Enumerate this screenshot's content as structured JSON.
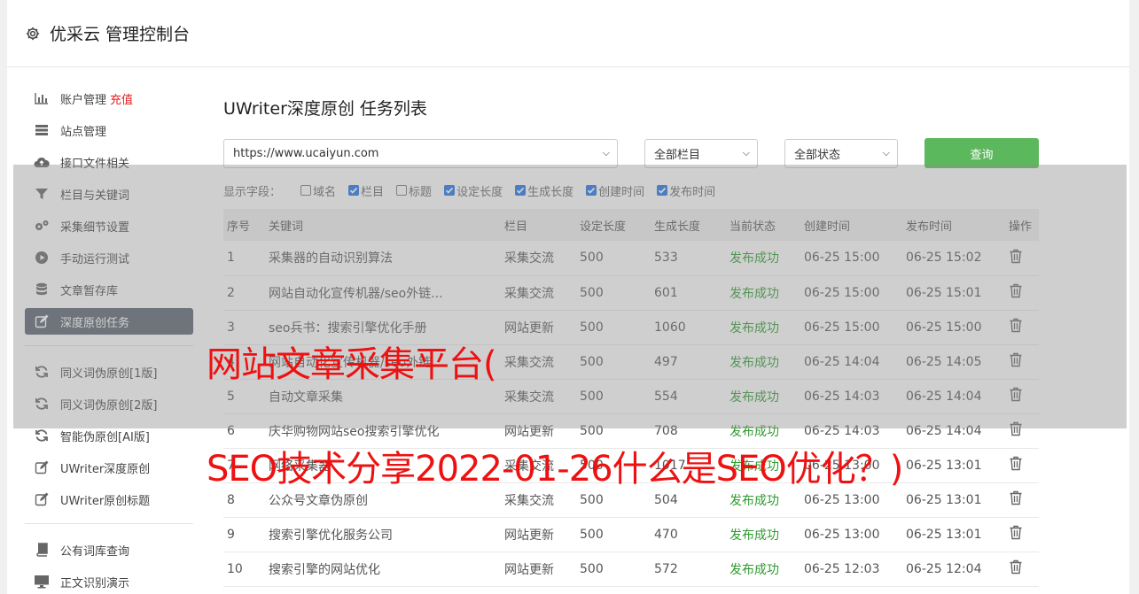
{
  "app": {
    "title": "优采云 管理控制台",
    "icon": "gear-icon"
  },
  "sidebar": {
    "items": [
      {
        "label": "账户管理",
        "badge": "充值",
        "icon": "bar-chart-icon"
      },
      {
        "label": "站点管理",
        "icon": "server-icon"
      },
      {
        "label": "接口文件相关",
        "icon": "cloud-upload-icon"
      },
      {
        "label": "栏目与关键词",
        "icon": "filter-icon"
      },
      {
        "label": "采集细节设置",
        "icon": "cogs-icon"
      },
      {
        "label": "手动运行测试",
        "icon": "play-circle-icon"
      },
      {
        "label": "文章暂存库",
        "icon": "database-icon"
      },
      {
        "label": "深度原创任务",
        "icon": "edit-icon",
        "active": true
      },
      {
        "label": "同义词伪原创[1版]",
        "icon": "refresh-icon"
      },
      {
        "label": "同义词伪原创[2版]",
        "icon": "refresh-icon"
      },
      {
        "label": "智能伪原创[AI版]",
        "icon": "refresh-icon"
      },
      {
        "label": "UWriter深度原创",
        "icon": "edit-icon"
      },
      {
        "label": "UWriter原创标题",
        "icon": "edit-icon"
      },
      {
        "label": "公有词库查询",
        "icon": "book-icon"
      },
      {
        "label": "正文识别演示",
        "icon": "monitor-icon"
      }
    ]
  },
  "main": {
    "title": "UWriter深度原创 任务列表",
    "site_select": "https://www.ucaiyun.com",
    "column_select": "全部栏目",
    "status_select": "全部状态",
    "query_label": "查询",
    "fields_label": "显示字段：",
    "fields": [
      {
        "label": "域名",
        "checked": false
      },
      {
        "label": "栏目",
        "checked": true
      },
      {
        "label": "标题",
        "checked": false
      },
      {
        "label": "设定长度",
        "checked": true
      },
      {
        "label": "生成长度",
        "checked": true
      },
      {
        "label": "创建时间",
        "checked": true
      },
      {
        "label": "发布时间",
        "checked": true
      }
    ],
    "table": {
      "headers": [
        "序号",
        "关键词",
        "栏目",
        "设定长度",
        "生成长度",
        "当前状态",
        "创建时间",
        "发布时间",
        "操作"
      ],
      "rows": [
        [
          "1",
          "采集器的自动识别算法",
          "采集交流",
          "500",
          "533",
          "发布成功",
          "06-25 15:00",
          "06-25 15:02"
        ],
        [
          "2",
          "网站自动化宣传机器/seo外链...",
          "采集交流",
          "500",
          "601",
          "发布成功",
          "06-25 15:00",
          "06-25 15:01"
        ],
        [
          "3",
          "seo兵书：搜索引擎优化手册",
          "网站更新",
          "500",
          "1060",
          "发布成功",
          "06-25 15:00",
          "06-25 15:00"
        ],
        [
          "4",
          "网站自动化宣传机器/seo外链...",
          "采集交流",
          "500",
          "497",
          "发布成功",
          "06-25 14:04",
          "06-25 14:05"
        ],
        [
          "5",
          "自动文章采集",
          "采集交流",
          "500",
          "554",
          "发布成功",
          "06-25 14:03",
          "06-25 14:04"
        ],
        [
          "6",
          "庆华购物网站seo搜索引擎优化",
          "网站更新",
          "500",
          "708",
          "发布成功",
          "06-25 14:03",
          "06-25 14:04"
        ],
        [
          "7",
          "网络采集器",
          "采集交流",
          "500",
          "1017",
          "发布成功",
          "06-25 13:00",
          "06-25 13:01"
        ],
        [
          "8",
          "公众号文章伪原创",
          "采集交流",
          "500",
          "504",
          "发布成功",
          "06-25 13:00",
          "06-25 13:01"
        ],
        [
          "9",
          "搜索引擎优化服务公司",
          "网站更新",
          "500",
          "470",
          "发布成功",
          "06-25 13:00",
          "06-25 13:01"
        ],
        [
          "10",
          "搜索引擎的网站优化",
          "网站更新",
          "500",
          "572",
          "发布成功",
          "06-25 12:03",
          "06-25 12:04"
        ]
      ]
    }
  },
  "overlay": {
    "headline_1": "网站文章采集平台(",
    "headline_2": "SEO技术分享2022-01-26什么是SEO优化？)"
  },
  "colors": {
    "accent_green": "#5cb85c",
    "status_green": "#2e9a2e",
    "headline_red": "#e11111",
    "sidebar_active": "#5b6371"
  }
}
